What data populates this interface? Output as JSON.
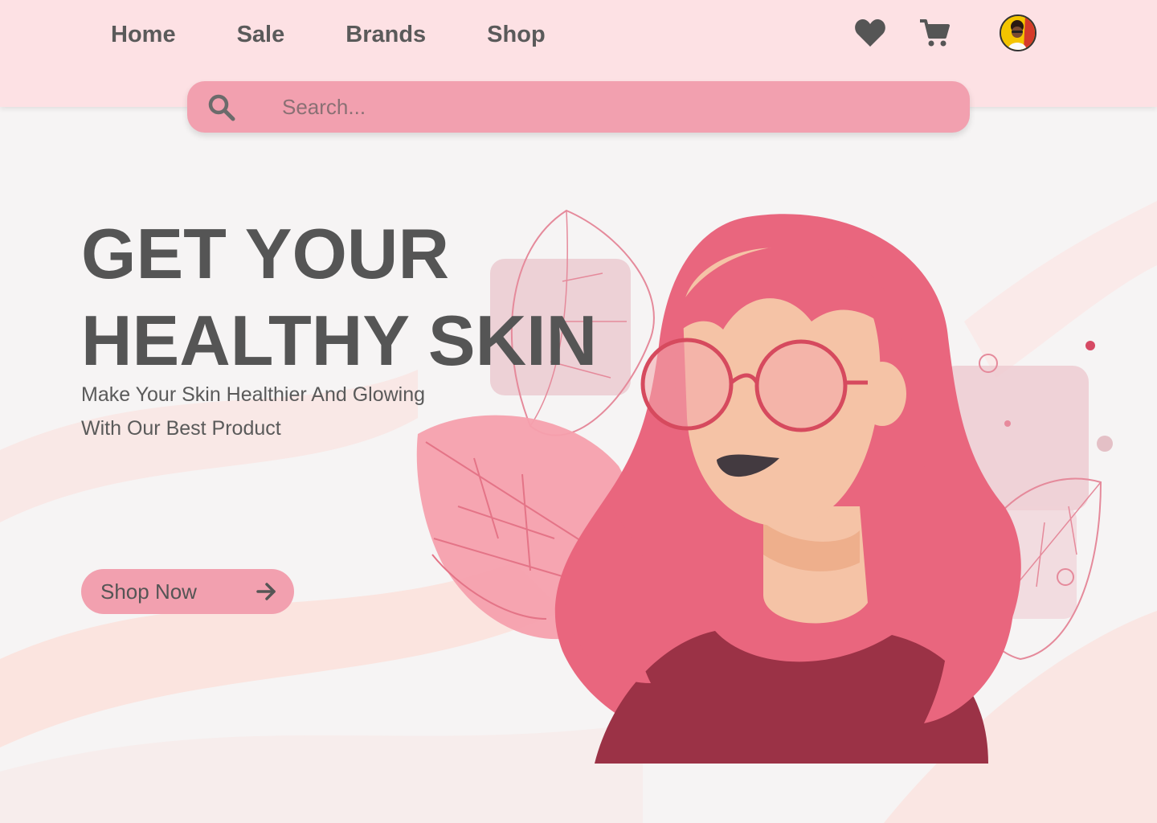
{
  "nav": {
    "items": [
      "Home",
      "Sale",
      "Brands",
      "Shop"
    ]
  },
  "header_icons": {
    "wishlist": "heart-icon",
    "cart": "cart-icon",
    "profile": "avatar"
  },
  "search": {
    "placeholder": "Search...",
    "value": ""
  },
  "hero": {
    "title_line1": "GET YOUR",
    "title_line2": "HEALTHY SKIN",
    "subtitle_line1": "Make Your Skin Healthier And Glowing",
    "subtitle_line2": "With Our Best Product",
    "cta_label": "Shop Now"
  },
  "colors": {
    "header_bg": "#fde1e4",
    "search_bg": "#f2a0af",
    "accent_pink": "#e9667e",
    "text_dark": "#555555",
    "shirt": "#9b3246"
  }
}
